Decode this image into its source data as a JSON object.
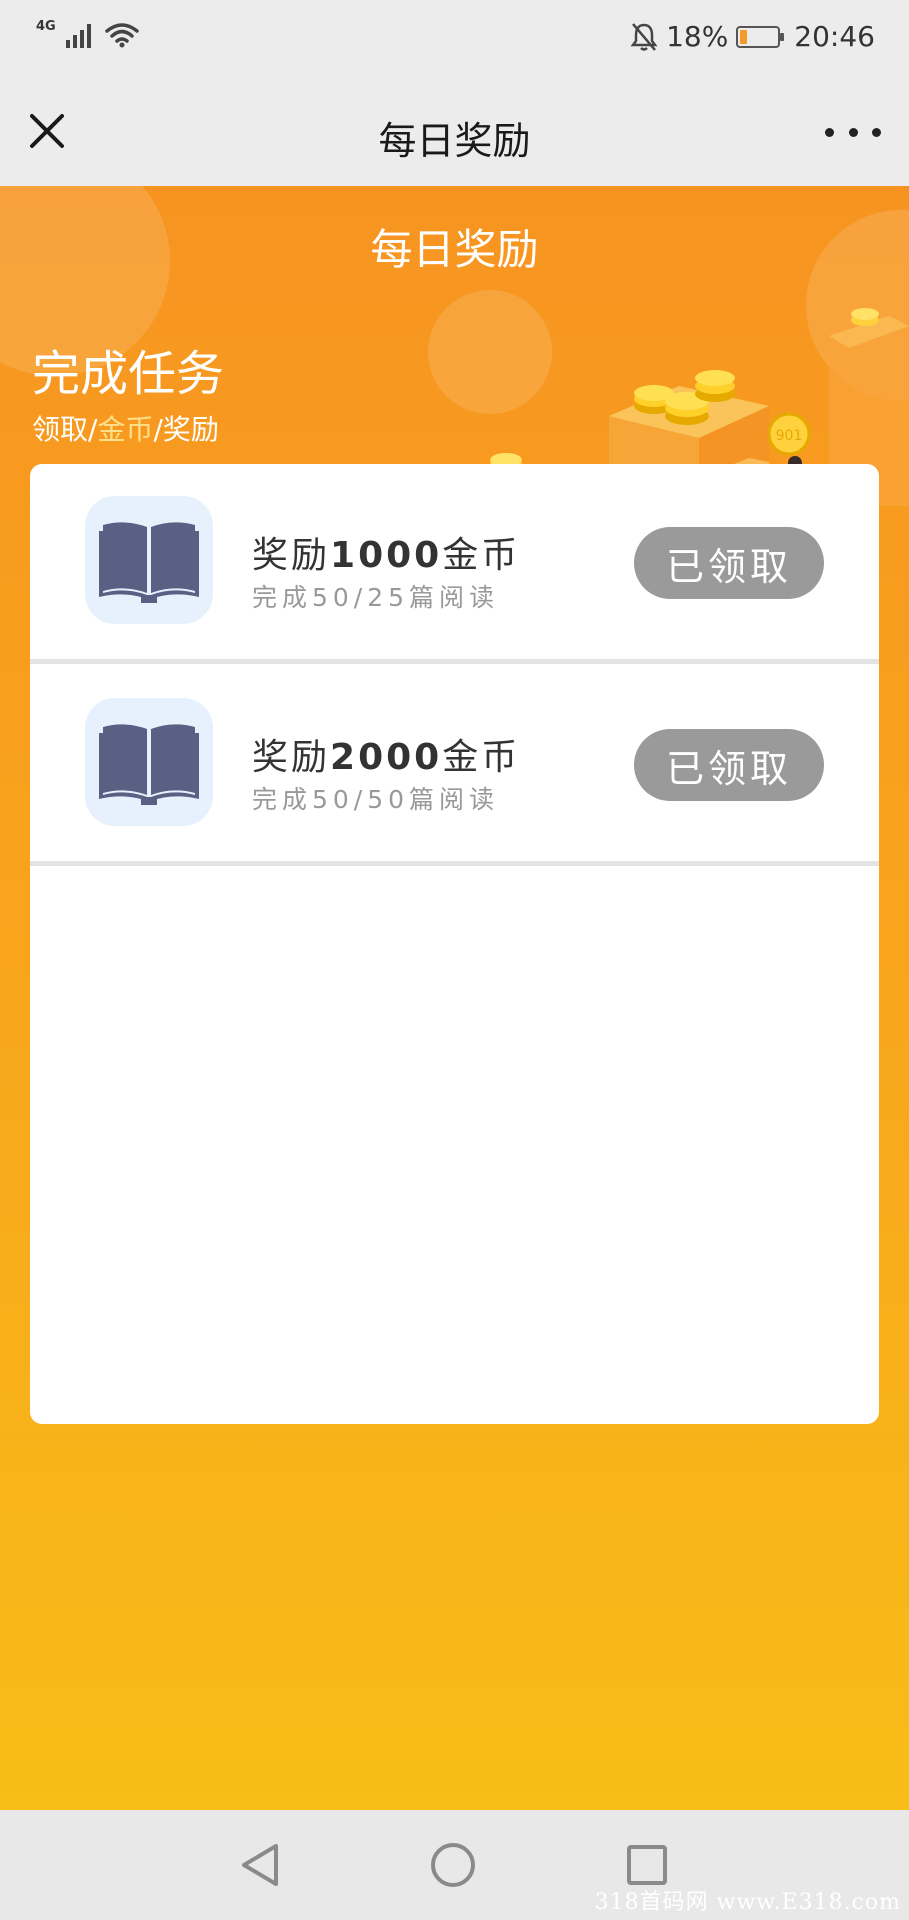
{
  "status_bar": {
    "network": "4G",
    "battery_percent": "18%",
    "battery_level": 0.18,
    "time": "20:46"
  },
  "header": {
    "title": "每日奖励",
    "close_icon": "close-icon",
    "more_icon": "more-icon"
  },
  "page": {
    "title": "每日奖励",
    "hero_title": "完成任务",
    "hero_sub": {
      "part1": "领取/",
      "part2": "金币",
      "part3": "/奖励"
    }
  },
  "tasks": [
    {
      "title_prefix": "奖励",
      "amount": "1000",
      "title_suffix": "金币",
      "desc": "完成50/25篇阅读",
      "button_label": "已领取",
      "icon": "book-icon"
    },
    {
      "title_prefix": "奖励",
      "amount": "2000",
      "title_suffix": "金币",
      "desc": "完成50/50篇阅读",
      "button_label": "已领取",
      "icon": "book-icon"
    }
  ],
  "watermark": "318首码网 www.E318.com",
  "colors": {
    "accent": "#f79421",
    "button_disabled": "#9a9a9a",
    "icon_bg": "#e6f1fd",
    "book": "#5a5f84"
  }
}
